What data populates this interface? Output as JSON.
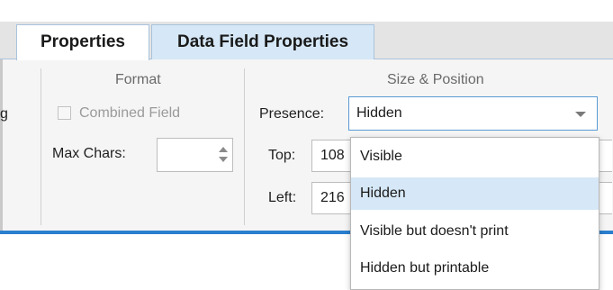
{
  "tabs": [
    {
      "label": "Properties",
      "active": true
    },
    {
      "label": "Data Field Properties",
      "active": false
    }
  ],
  "partial_label_left": "g",
  "format": {
    "group_label": "Format",
    "combined_field_label": "Combined Field",
    "combined_field_checked": false,
    "max_chars_label": "Max Chars:",
    "max_chars_value": ""
  },
  "size_position": {
    "group_label": "Size & Position",
    "presence_label": "Presence:",
    "presence_value": "Hidden",
    "top_label": "Top:",
    "top_value": "108",
    "left_label": "Left:",
    "left_value": "216"
  },
  "presence_dropdown": {
    "options": [
      "Visible",
      "Hidden",
      "Visible but doesn't print",
      "Hidden but printable"
    ],
    "selected_index": 1
  },
  "colors": {
    "accent": "#2a7fce",
    "selected_highlight": "#d6e8f7",
    "focus_border": "#5b9bd5"
  }
}
